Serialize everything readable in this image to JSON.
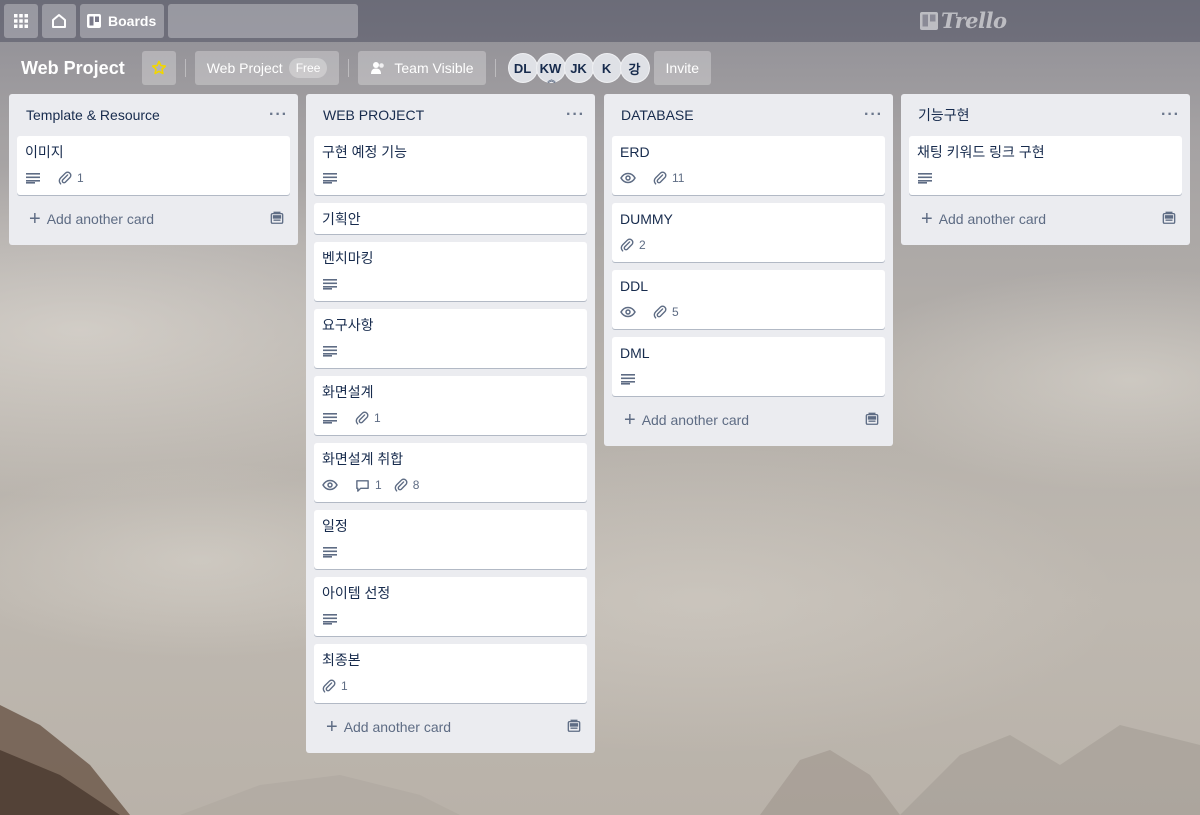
{
  "header": {
    "boards_label": "Boards",
    "search_placeholder": "",
    "logo_text": "Trello"
  },
  "board": {
    "title": "Web Project",
    "team_name": "Web Project",
    "plan_badge": "Free",
    "visibility": "Team Visible",
    "invite_label": "Invite",
    "members": [
      "DL",
      "KW",
      "JK",
      "K",
      "강"
    ]
  },
  "add_card_label": "Add another card",
  "lists": [
    {
      "title": "Template & Resource",
      "cards": [
        {
          "title": "이미지",
          "description": true,
          "attachments": "1"
        }
      ]
    },
    {
      "title": "WEB PROJECT",
      "cards": [
        {
          "title": "구현 예정 기능",
          "description": true
        },
        {
          "title": "기획안"
        },
        {
          "title": "벤치마킹",
          "description": true
        },
        {
          "title": "요구사항",
          "description": true
        },
        {
          "title": "화면설계",
          "description": true,
          "attachments": "1"
        },
        {
          "title": "화면설계 취합",
          "watching": true,
          "comments": "1",
          "attachments": "8"
        },
        {
          "title": "일정",
          "description": true
        },
        {
          "title": "아이템 선정",
          "description": true
        },
        {
          "title": "최종본",
          "attachments": "1"
        }
      ]
    },
    {
      "title": "DATABASE",
      "cards": [
        {
          "title": "ERD",
          "watching": true,
          "attachments": "11"
        },
        {
          "title": "DUMMY",
          "attachments": "2"
        },
        {
          "title": "DDL",
          "watching": true,
          "attachments": "5"
        },
        {
          "title": "DML",
          "description": true
        }
      ]
    },
    {
      "title": "기능구현",
      "cards": [
        {
          "title": "채팅 키워드 링크 구현",
          "description": true
        }
      ]
    }
  ],
  "colors": {
    "list_bg": "#ebecf0",
    "card_bg": "#ffffff",
    "text": "#172b4d",
    "muted": "#5e6c84",
    "star": "#f2d600"
  }
}
